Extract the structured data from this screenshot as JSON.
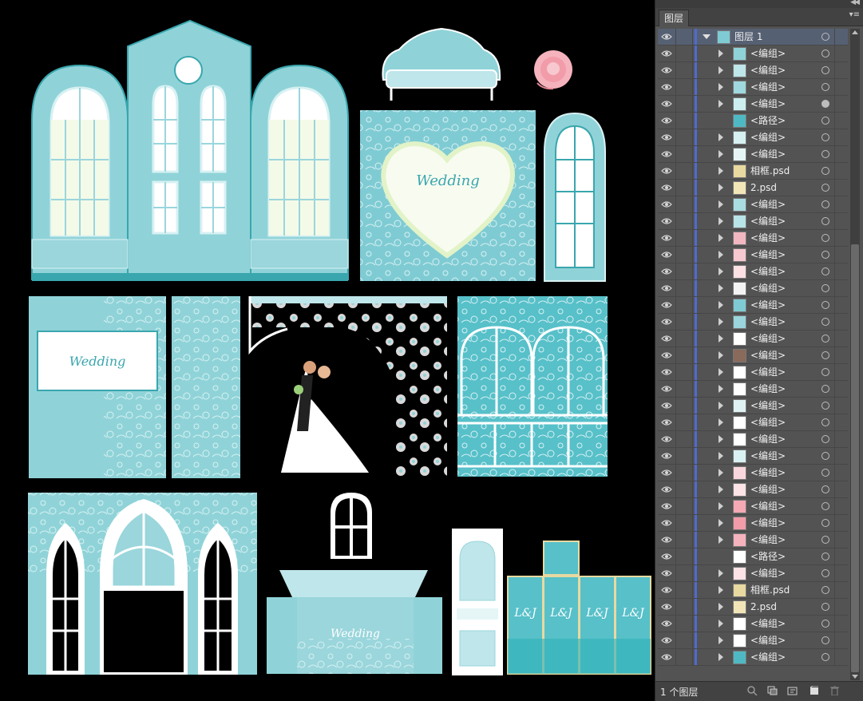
{
  "panel": {
    "tab_label": "图层",
    "footer_count": "1 个图层"
  },
  "layers": [
    {
      "name": "图层 1",
      "top": true,
      "selected": true,
      "thumb": "#7fcbd3"
    },
    {
      "name": "<编组>",
      "thumb": "#8fd3d8"
    },
    {
      "name": "<编组>",
      "thumb": "#bfe6ea"
    },
    {
      "name": "<编组>",
      "thumb": "#9fd8de"
    },
    {
      "name": "<编组>",
      "thumb": "#cdeef0",
      "filled": true
    },
    {
      "name": "<路径>",
      "thumb": "#4fb9c3",
      "noarrow": true
    },
    {
      "name": "<编组>",
      "thumb": "#d7f0f2"
    },
    {
      "name": "<编组>",
      "thumb": "#e6f6f7"
    },
    {
      "name": "相框.psd",
      "thumb": "#e8d9a0"
    },
    {
      "name": "2.psd",
      "thumb": "#f2e6b8"
    },
    {
      "name": "<编组>",
      "thumb": "#a9dde2"
    },
    {
      "name": "<编组>",
      "thumb": "#b8e3e7"
    },
    {
      "name": "<编组>",
      "thumb": "#f2b7c0"
    },
    {
      "name": "<编组>",
      "thumb": "#f7c8cf"
    },
    {
      "name": "<编组>",
      "thumb": "#fbe0e4"
    },
    {
      "name": "<编组>",
      "thumb": "#f3f3f3"
    },
    {
      "name": "<编组>",
      "thumb": "#7fcbd3"
    },
    {
      "name": "<编组>",
      "thumb": "#9ad6dc"
    },
    {
      "name": "<编组>",
      "thumb": "#ffffff"
    },
    {
      "name": "<编组>",
      "thumb": "#8a6a5a"
    },
    {
      "name": "<编组>",
      "thumb": "#ffffff"
    },
    {
      "name": "<编组>",
      "thumb": "#ffffff"
    },
    {
      "name": "<编组>",
      "thumb": "#e0f3f4"
    },
    {
      "name": "<编组>",
      "thumb": "#ffffff"
    },
    {
      "name": "<编组>",
      "thumb": "#ffffff"
    },
    {
      "name": "<编组>",
      "thumb": "#d9f1f3"
    },
    {
      "name": "<编组>",
      "thumb": "#f8d8dd"
    },
    {
      "name": "<编组>",
      "thumb": "#fbe3e6"
    },
    {
      "name": "<编组>",
      "thumb": "#f4a9b4"
    },
    {
      "name": "<编组>",
      "thumb": "#f29ca9"
    },
    {
      "name": "<编组>",
      "thumb": "#f5b3bd"
    },
    {
      "name": "<路径>",
      "thumb": "#ffffff",
      "noarrow": true
    },
    {
      "name": "<编组>",
      "thumb": "#fbe3e6"
    },
    {
      "name": "相框.psd",
      "thumb": "#e8d9a0"
    },
    {
      "name": "2.psd",
      "thumb": "#f2e6b8"
    },
    {
      "name": "<编组>",
      "thumb": "#ffffff"
    },
    {
      "name": "<编组>",
      "thumb": "#ffffff"
    },
    {
      "name": "<编组>",
      "thumb": "#4fb9c3"
    }
  ],
  "artwork": {
    "wedding_word": "Wedding",
    "teal": "#8fd3d8",
    "teal_dark": "#3aa6ae",
    "teal_light": "#bfe6ea",
    "monogram_text": "L&J"
  }
}
